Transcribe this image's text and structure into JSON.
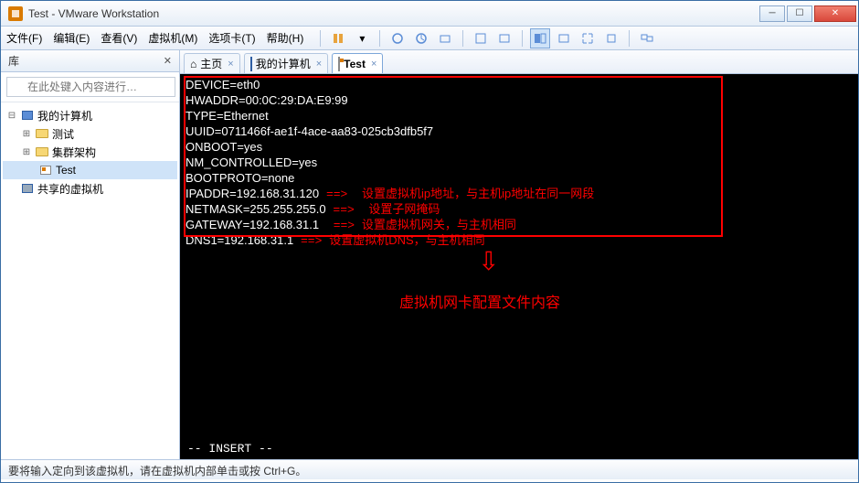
{
  "window": {
    "title": "Test - VMware Workstation"
  },
  "menu": {
    "file": "文件(F)",
    "edit": "编辑(E)",
    "view": "查看(V)",
    "vm": "虚拟机(M)",
    "tabs": "选项卡(T)",
    "help": "帮助(H)"
  },
  "sidebar": {
    "title": "库",
    "search_placeholder": "在此处键入内容进行…",
    "tree": {
      "root": "我的计算机",
      "items": [
        "测试",
        "集群架构",
        "Test"
      ],
      "shared": "共享的虚拟机"
    }
  },
  "tabs": {
    "home": "主页",
    "mypc": "我的计算机",
    "test": "Test"
  },
  "terminal": {
    "lines": [
      "DEVICE=eth0",
      "HWADDR=00:0C:29:DA:E9:99",
      "TYPE=Ethernet",
      "UUID=0711466f-ae1f-4ace-aa83-025cb3dfb5f7",
      "ONBOOT=yes",
      "NM_CONTROLLED=yes",
      "BOOTPROTO=none",
      "IPADDR=192.168.31.120",
      "NETMASK=255.255.255.0",
      "GATEWAY=192.168.31.1",
      "DNS1=192.168.31.1"
    ],
    "annotations": {
      "ipaddr": "设置虚拟机ip地址，与主机ip地址在同一网段",
      "netmask": "设置子网掩码",
      "gateway": "设置虚拟机网关，与主机相同",
      "dns1": "设置虚拟机DNS，与主机相同"
    },
    "caption": "虚拟机网卡配置文件内容",
    "mode": "-- INSERT --"
  },
  "status": "要将输入定向到该虚拟机，请在虚拟机内部单击或按 Ctrl+G。"
}
